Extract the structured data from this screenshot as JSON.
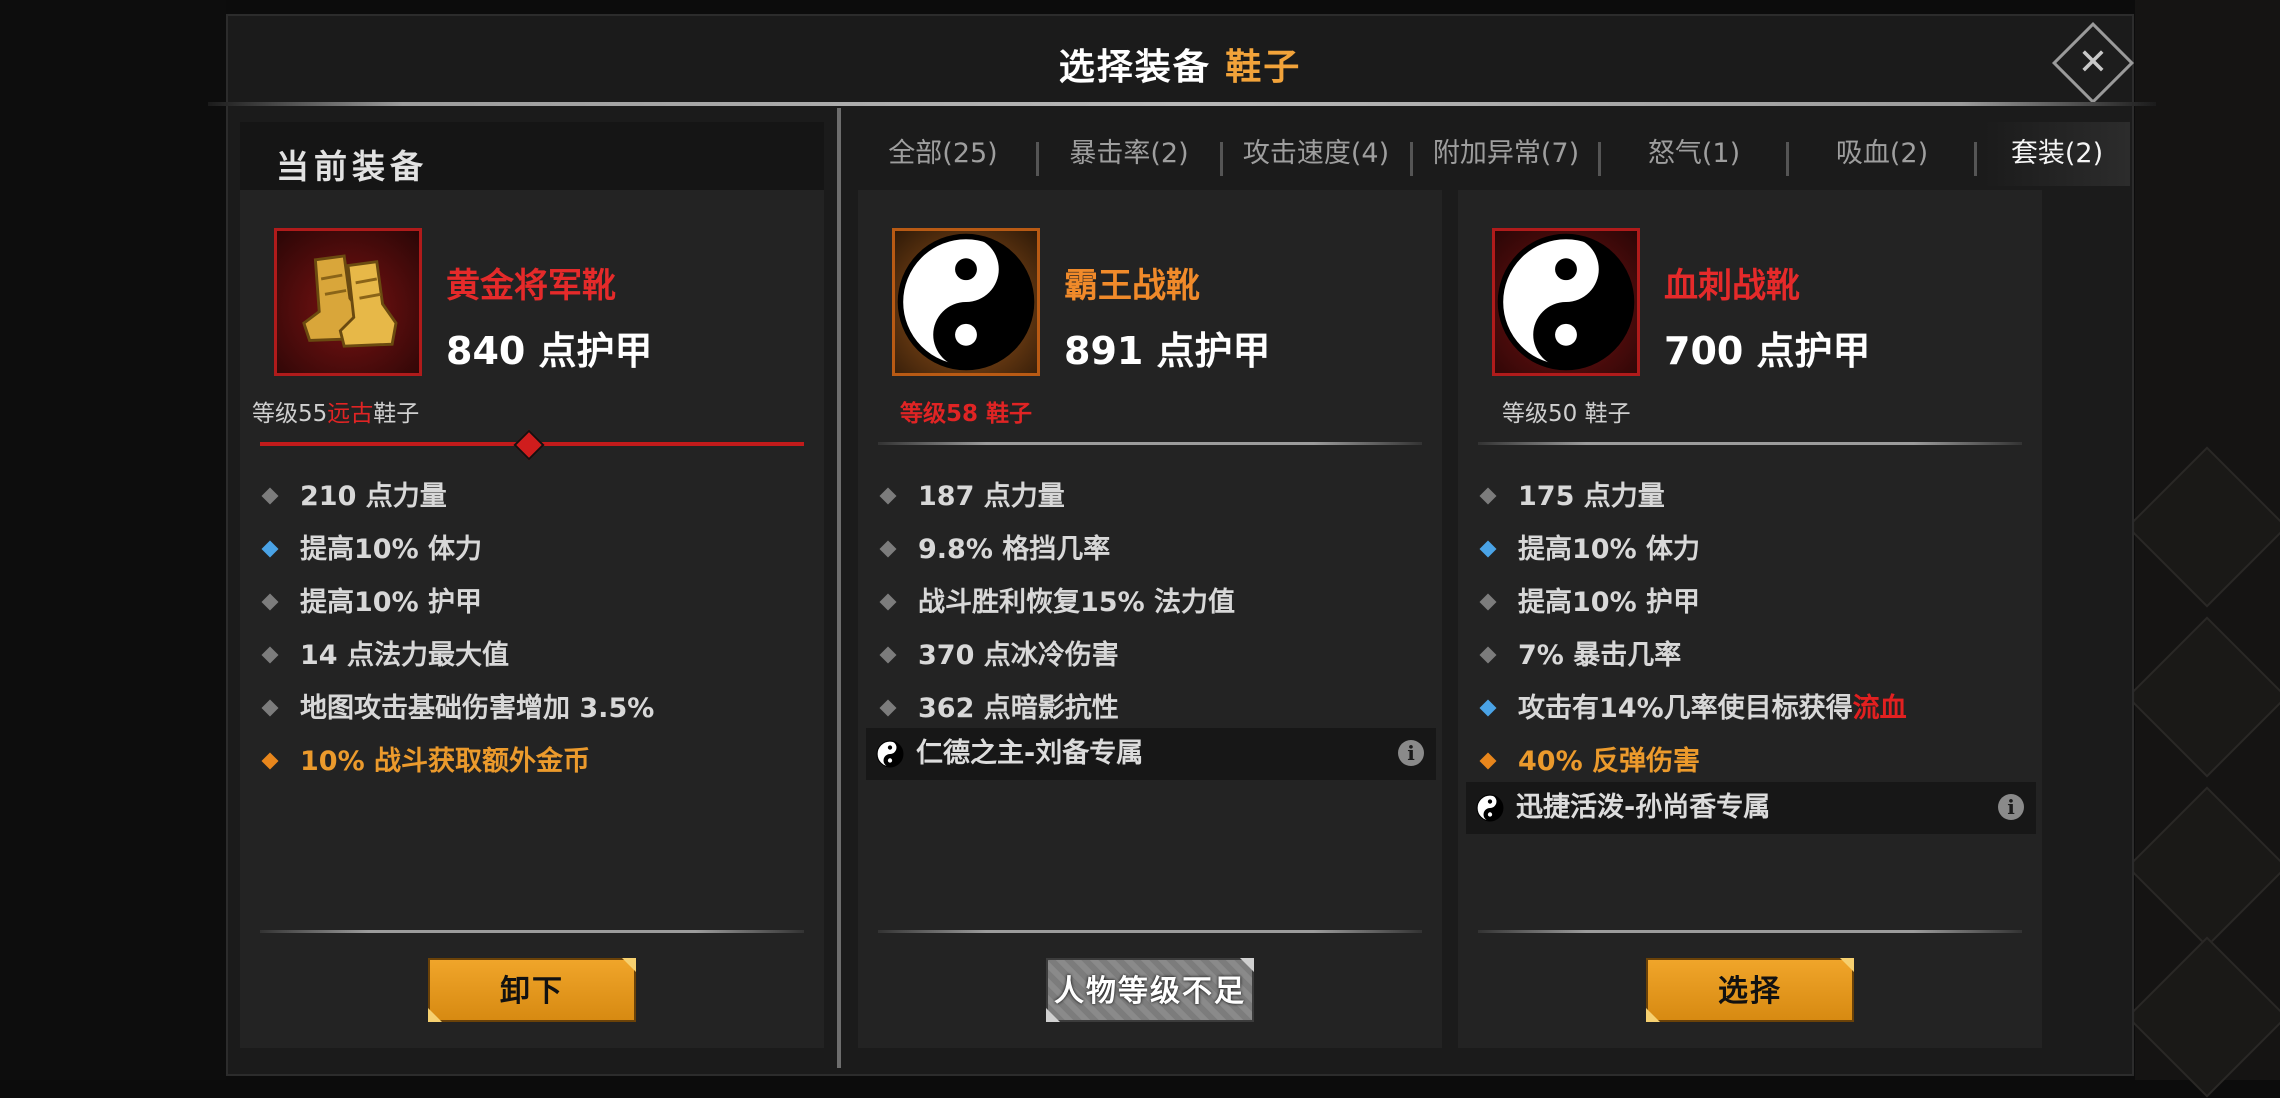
{
  "title": {
    "main": "选择装备",
    "accent": "鞋子"
  },
  "current_header": "当前装备",
  "tabs": [
    {
      "label": "全部(25)"
    },
    {
      "label": "暴击率(2)"
    },
    {
      "label": "攻击速度(4)"
    },
    {
      "label": "附加异常(7)"
    },
    {
      "label": "怒气(1)"
    },
    {
      "label": "吸血(2)"
    },
    {
      "label": "套装(2)"
    }
  ],
  "cards": [
    {
      "name": "黄金将军靴",
      "name_color": "#e52a2a",
      "armor": "840 点护甲",
      "level_prefix": "等级55",
      "level_quality": "远古",
      "level_suffix": "鞋子",
      "stats": [
        {
          "text": "210 点力量",
          "bullet": "gray"
        },
        {
          "text": "提高10% 体力",
          "bullet": "blue"
        },
        {
          "text": "提高10% 护甲",
          "bullet": "gray"
        },
        {
          "text": "14 点法力最大值",
          "bullet": "gray"
        },
        {
          "text": "地图攻击基础伤害增加 3.5%",
          "bullet": "gray"
        },
        {
          "text": "10% 战斗获取额外金币",
          "bullet": "orange"
        }
      ],
      "button": "卸下"
    },
    {
      "name": "霸王战靴",
      "name_color": "#f08a2a",
      "armor": "891 点护甲",
      "level": "等级58 鞋子",
      "stats": [
        {
          "text": "187 点力量",
          "bullet": "gray"
        },
        {
          "text": "9.8% 格挡几率",
          "bullet": "gray"
        },
        {
          "text": "战斗胜利恢复15% 法力值",
          "bullet": "gray"
        },
        {
          "text": "370 点冰冷伤害",
          "bullet": "gray"
        },
        {
          "text": "362 点暗影抗性",
          "bullet": "gray"
        }
      ],
      "set_text": "仁德之主-刘备专属",
      "button": "人物等级不足"
    },
    {
      "name": "血刺战靴",
      "name_color": "#e52a2a",
      "armor": "700 点护甲",
      "level": "等级50 鞋子",
      "stats": [
        {
          "text": "175 点力量",
          "bullet": "gray"
        },
        {
          "text": "提高10% 体力",
          "bullet": "blue"
        },
        {
          "text": "提高10% 护甲",
          "bullet": "gray"
        },
        {
          "text": "7% 暴击几率",
          "bullet": "gray"
        }
      ],
      "stat5_text": "攻击有14%几率使目标获得",
      "stat5_red": "流血",
      "stat6_text": "40% 反弹伤害",
      "set_text": "迅捷活泼-孙尚香专属",
      "button": "选择"
    }
  ]
}
